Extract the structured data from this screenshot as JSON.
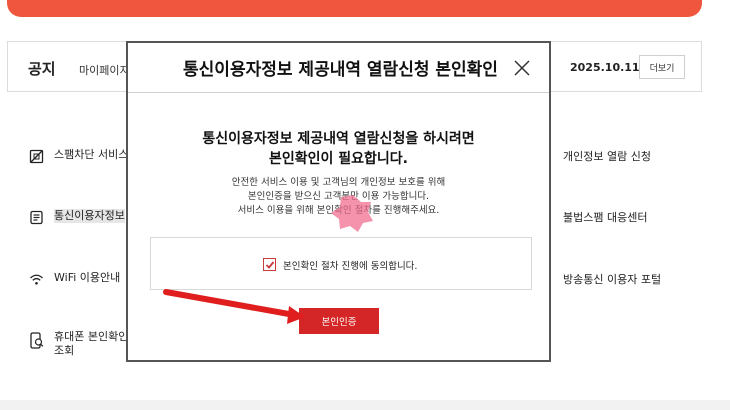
{
  "notice": {
    "title": "공지",
    "text": "마이페이지",
    "date": "2025.10.11",
    "more_label": "더보기"
  },
  "menu_left": [
    {
      "label_lines": [
        "스팸차단 서비스"
      ],
      "icon": "spam-block-icon"
    },
    {
      "label_lines": [
        "통신이용자정보"
      ],
      "icon": "document-list-icon"
    },
    {
      "label_lines": [
        "WiFi 이용안내"
      ],
      "icon": "wifi-icon"
    },
    {
      "label_lines": [
        "휴대폰 본인확인",
        "조회"
      ],
      "icon": "phone-search-icon"
    }
  ],
  "menu_right": [
    {
      "label": "개인정보 열람 신청"
    },
    {
      "label": "불법스팸 대응센터"
    },
    {
      "label": "방송통신 이용자 포털"
    }
  ],
  "modal": {
    "title": "통신이용자정보 제공내역 열람신청 본인확인",
    "headline_1": "통신이용자정보 제공내역 열람신청을 하시려면",
    "headline_2": "본인확인이 필요합니다.",
    "desc_1": "안전한 서비스 이용 및 고객님의 개인정보 보호를 위해",
    "desc_2": "본인인증을 받으신 고객분만 이용 가능합니다.",
    "desc_3": "서비스 이용을 위해 본인확인 절차를 진행해주세요.",
    "agree_label": "본인확인 절차 진행에 동의합니다.",
    "agree_checked": true,
    "verify_button": "본인인증"
  },
  "colors": {
    "brand_red": "#d42626",
    "banner_orange": "#f0553e",
    "annotation_arrow": "#e01e1e"
  }
}
